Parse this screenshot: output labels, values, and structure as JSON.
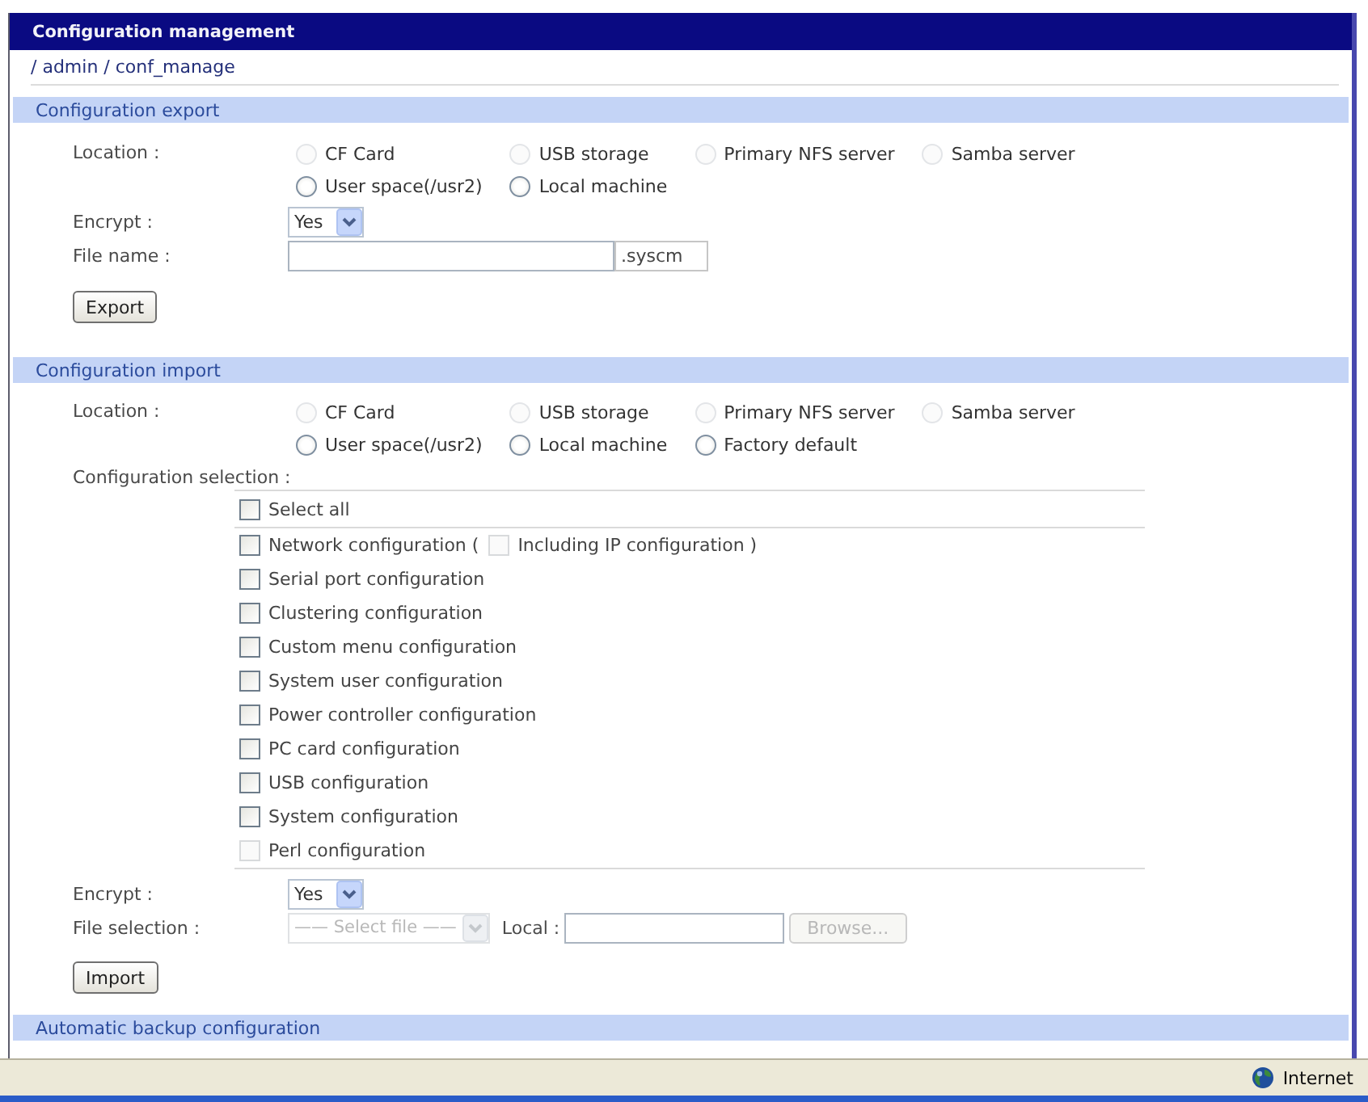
{
  "window": {
    "title": "Configuration management"
  },
  "breadcrumb": "/ admin / conf_manage",
  "export": {
    "title": "Configuration export",
    "location": {
      "label": "Location :",
      "options": [
        {
          "label": "CF Card",
          "selected": false,
          "disabled": true
        },
        {
          "label": "USB storage",
          "selected": false,
          "disabled": true
        },
        {
          "label": "Primary NFS server",
          "selected": false,
          "disabled": true
        },
        {
          "label": "Samba server",
          "selected": false,
          "disabled": true
        },
        {
          "label": "User space(/usr2)",
          "selected": false,
          "disabled": false
        },
        {
          "label": "Local machine",
          "selected": false,
          "disabled": false
        }
      ]
    },
    "encrypt": {
      "label": "Encrypt :",
      "value": "Yes"
    },
    "file_name": {
      "label": "File name :",
      "suffix": ".syscm"
    },
    "button": "Export"
  },
  "import": {
    "title": "Configuration import",
    "location": {
      "label": "Location :",
      "options": [
        {
          "label": "CF Card",
          "selected": false,
          "disabled": true
        },
        {
          "label": "USB storage",
          "selected": false,
          "disabled": true
        },
        {
          "label": "Primary NFS server",
          "selected": false,
          "disabled": true
        },
        {
          "label": "Samba server",
          "selected": false,
          "disabled": true
        },
        {
          "label": "User space(/usr2)",
          "selected": false,
          "disabled": false
        },
        {
          "label": "Local machine",
          "selected": false,
          "disabled": false
        },
        {
          "label": "Factory default",
          "selected": false,
          "disabled": false
        }
      ]
    },
    "selection": {
      "label": "Configuration selection :",
      "items": [
        {
          "kind": "select_all",
          "label": "Select all",
          "checked": false,
          "disabled": false
        },
        {
          "kind": "option",
          "label": "Network configuration (",
          "checked": false,
          "disabled": false,
          "option": {
            "label": "Including IP configuration )",
            "checked": false,
            "disabled": true
          }
        },
        {
          "kind": "option",
          "label": "Serial port configuration",
          "checked": false,
          "disabled": false
        },
        {
          "kind": "option",
          "label": "Clustering configuration",
          "checked": false,
          "disabled": false
        },
        {
          "kind": "option",
          "label": "Custom menu configuration",
          "checked": false,
          "disabled": false
        },
        {
          "kind": "option",
          "label": "System user configuration",
          "checked": false,
          "disabled": false
        },
        {
          "kind": "option",
          "label": "Power controller configuration",
          "checked": false,
          "disabled": false
        },
        {
          "kind": "option",
          "label": "PC card configuration",
          "checked": false,
          "disabled": false
        },
        {
          "kind": "option",
          "label": "USB configuration",
          "checked": false,
          "disabled": false
        },
        {
          "kind": "option",
          "label": "System configuration",
          "checked": false,
          "disabled": false
        },
        {
          "kind": "option",
          "label": "Perl configuration",
          "checked": false,
          "disabled": true
        }
      ]
    },
    "encrypt": {
      "label": "Encrypt :",
      "value": "Yes"
    },
    "file_selection": {
      "label": "File selection :",
      "select": {
        "value": "—— Select file ——",
        "disabled": true
      },
      "local_label": "Local :",
      "browse": {
        "label": "Browse...",
        "disabled": true
      }
    },
    "button": "Import"
  },
  "auto_backup": {
    "title": "Automatic backup configuration"
  },
  "status_bar": {
    "zone": "Internet"
  }
}
